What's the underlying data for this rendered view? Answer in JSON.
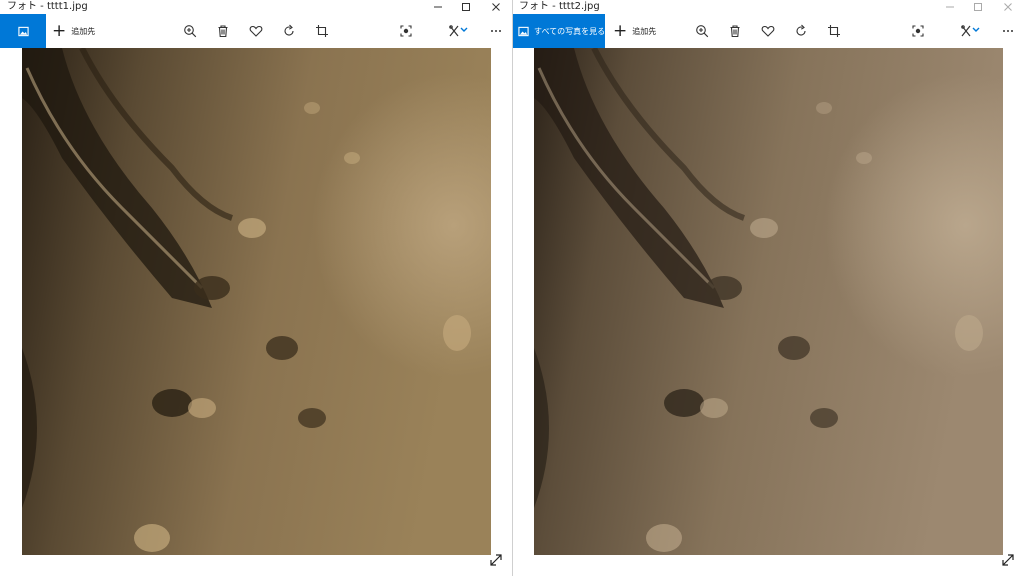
{
  "colors": {
    "accent": "#0078d7",
    "titlebar_text": "#222222",
    "icon": "#333333"
  },
  "windows": [
    {
      "title": "フォト - tttt1.jpg",
      "collection_label": "",
      "collection_icon": "photo-icon",
      "add_label": "追加先",
      "toolbar_icons": [
        "zoom-in-icon",
        "trash-icon",
        "heart-icon",
        "rotate-icon",
        "crop-icon",
        "enhance-icon",
        "edit-create-icon",
        "more-icon"
      ]
    },
    {
      "title": "フォト - tttt2.jpg",
      "collection_label": "すべての写真を見る",
      "collection_icon": "photo-icon",
      "add_label": "追加先",
      "toolbar_icons": [
        "zoom-in-icon",
        "trash-icon",
        "heart-icon",
        "rotate-icon",
        "crop-icon",
        "enhance-icon",
        "edit-create-icon",
        "more-icon"
      ]
    }
  ]
}
